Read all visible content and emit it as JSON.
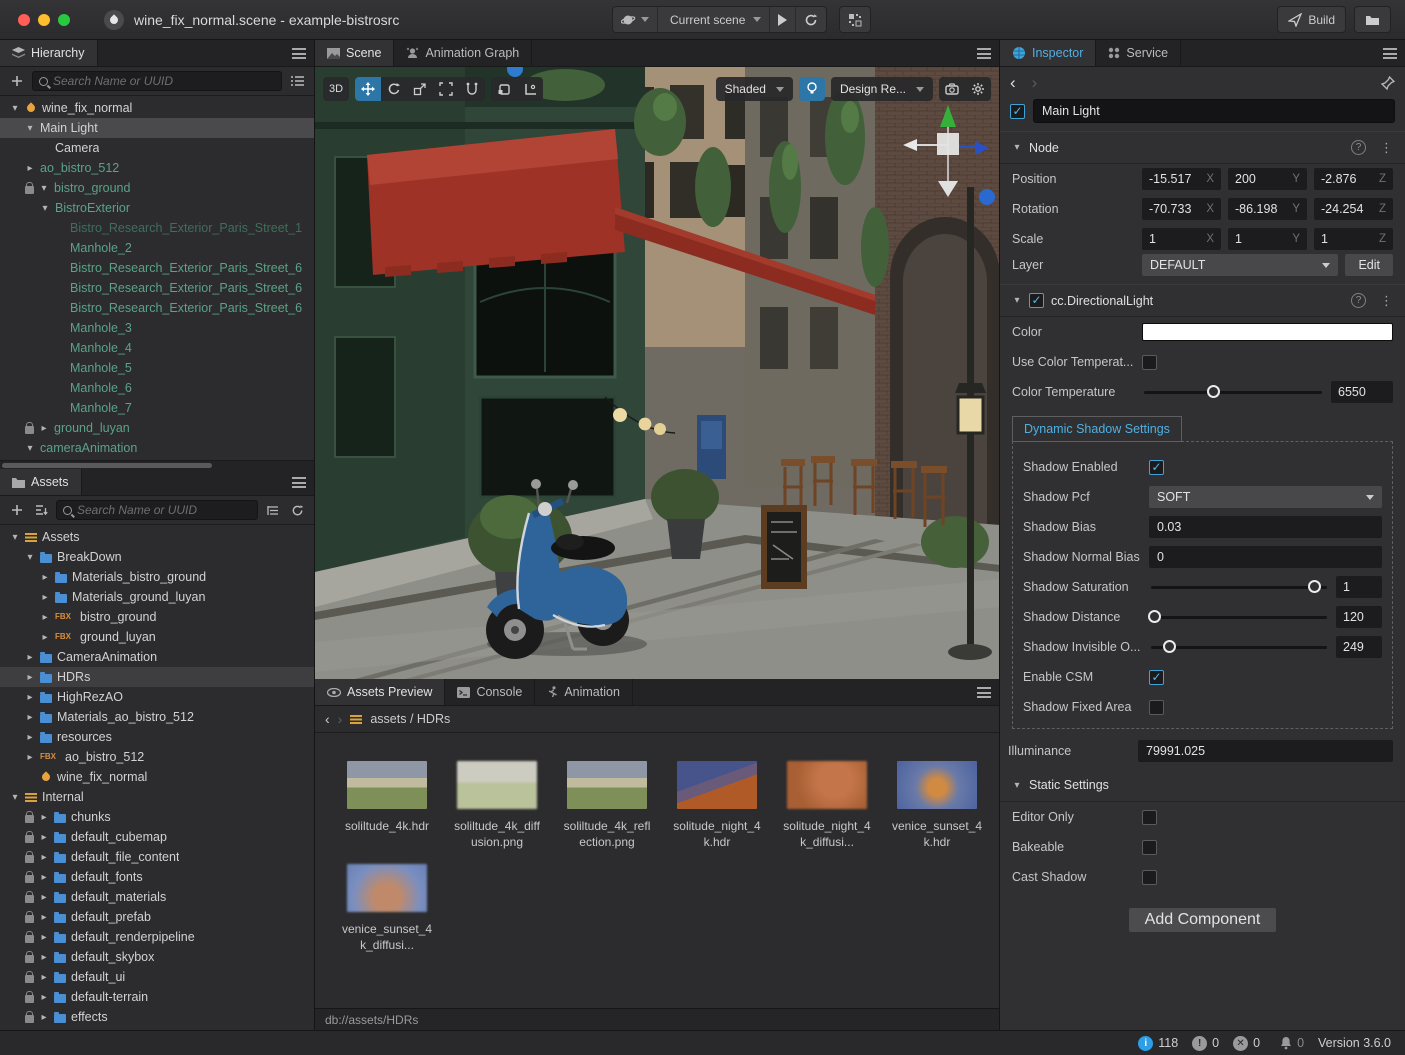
{
  "titlebar": {
    "title": "wine_fix_normal.scene - example-bistrosrc",
    "scene_select": "Current scene",
    "build_label": "Build"
  },
  "hierarchy": {
    "tab": "Hierarchy",
    "search_placeholder": "Search Name or UUID",
    "items": [
      {
        "arrow": "down",
        "icon": "droplet",
        "label": "wine_fix_normal",
        "indent": 0
      },
      {
        "arrow": "down",
        "label": "Main Light",
        "indent": 1,
        "cls": "selected"
      },
      {
        "label": "Camera",
        "indent": 2
      },
      {
        "arrow": "right",
        "label": "ao_bistro_512",
        "indent": 1,
        "cls": "green"
      },
      {
        "lock": true,
        "arrow": "down",
        "label": "bistro_ground",
        "indent": 1,
        "cls": "green"
      },
      {
        "arrow": "down",
        "label": "BistroExterior",
        "indent": 2,
        "cls": "green"
      },
      {
        "label": "Bistro_Research_Exterior_Paris_Street_1",
        "indent": 3,
        "cls": "green dim"
      },
      {
        "label": "Manhole_2",
        "indent": 3,
        "cls": "green"
      },
      {
        "label": "Bistro_Research_Exterior_Paris_Street_6",
        "indent": 3,
        "cls": "green"
      },
      {
        "label": "Bistro_Research_Exterior_Paris_Street_6",
        "indent": 3,
        "cls": "green"
      },
      {
        "label": "Bistro_Research_Exterior_Paris_Street_6",
        "indent": 3,
        "cls": "green"
      },
      {
        "label": "Manhole_3",
        "indent": 3,
        "cls": "green"
      },
      {
        "label": "Manhole_4",
        "indent": 3,
        "cls": "green"
      },
      {
        "label": "Manhole_5",
        "indent": 3,
        "cls": "green"
      },
      {
        "label": "Manhole_6",
        "indent": 3,
        "cls": "green"
      },
      {
        "label": "Manhole_7",
        "indent": 3,
        "cls": "green"
      },
      {
        "lock": true,
        "arrow": "right",
        "label": "ground_luyan",
        "indent": 1,
        "cls": "green"
      },
      {
        "arrow": "down",
        "label": "cameraAnimation",
        "indent": 1,
        "cls": "green"
      }
    ]
  },
  "assets": {
    "tab": "Assets",
    "search_placeholder": "Search Name or UUID",
    "items": [
      {
        "arrow": "down",
        "icon": "db",
        "label": "Assets",
        "indent": 0
      },
      {
        "arrow": "down",
        "icon": "folder",
        "label": "BreakDown",
        "indent": 1
      },
      {
        "arrow": "right",
        "icon": "folder",
        "label": "Materials_bistro_ground",
        "indent": 2
      },
      {
        "arrow": "right",
        "icon": "folder",
        "label": "Materials_ground_luyan",
        "indent": 2
      },
      {
        "arrow": "right",
        "icon": "fbx",
        "label": "bistro_ground",
        "indent": 2
      },
      {
        "arrow": "right",
        "icon": "fbx",
        "label": "ground_luyan",
        "indent": 2
      },
      {
        "arrow": "right",
        "icon": "folder",
        "label": "CameraAnimation",
        "indent": 1
      },
      {
        "arrow": "right",
        "icon": "folder",
        "label": "HDRs",
        "indent": 1,
        "cls": "hl"
      },
      {
        "arrow": "right",
        "icon": "folder",
        "label": "HighRezAO",
        "indent": 1
      },
      {
        "arrow": "right",
        "icon": "folder",
        "label": "Materials_ao_bistro_512",
        "indent": 1
      },
      {
        "arrow": "right",
        "icon": "folder",
        "label": "resources",
        "indent": 1
      },
      {
        "arrow": "right",
        "icon": "fbx",
        "label": "ao_bistro_512",
        "indent": 1
      },
      {
        "icon": "droplet",
        "label": "wine_fix_normal",
        "indent": 1
      },
      {
        "arrow": "down",
        "icon": "db",
        "label": "Internal",
        "indent": 0
      },
      {
        "lock": true,
        "arrow": "right",
        "icon": "folder",
        "label": "chunks",
        "indent": 1
      },
      {
        "lock": true,
        "arrow": "right",
        "icon": "folder",
        "label": "default_cubemap",
        "indent": 1
      },
      {
        "lock": true,
        "arrow": "right",
        "icon": "folder",
        "label": "default_file_content",
        "indent": 1
      },
      {
        "lock": true,
        "arrow": "right",
        "icon": "folder",
        "label": "default_fonts",
        "indent": 1
      },
      {
        "lock": true,
        "arrow": "right",
        "icon": "folder",
        "label": "default_materials",
        "indent": 1
      },
      {
        "lock": true,
        "arrow": "right",
        "icon": "folder",
        "label": "default_prefab",
        "indent": 1
      },
      {
        "lock": true,
        "arrow": "right",
        "icon": "folder",
        "label": "default_renderpipeline",
        "indent": 1
      },
      {
        "lock": true,
        "arrow": "right",
        "icon": "folder",
        "label": "default_skybox",
        "indent": 1
      },
      {
        "lock": true,
        "arrow": "right",
        "icon": "folder",
        "label": "default_ui",
        "indent": 1
      },
      {
        "lock": true,
        "arrow": "right",
        "icon": "folder",
        "label": "default-terrain",
        "indent": 1
      },
      {
        "lock": true,
        "arrow": "right",
        "icon": "folder",
        "label": "effects",
        "indent": 1
      }
    ]
  },
  "scene": {
    "tabs": [
      {
        "label": "Scene"
      },
      {
        "label": "Animation Graph"
      }
    ],
    "mode": "3D",
    "shading": "Shaded",
    "design": "Design Re..."
  },
  "preview": {
    "tabs": [
      {
        "label": "Assets Preview"
      },
      {
        "label": "Console"
      },
      {
        "label": "Animation"
      }
    ],
    "breadcrumb": "assets / HDRs",
    "path": "db://assets/HDRs",
    "files": [
      {
        "name": "soliltude_4k.hdr",
        "thumb": "field"
      },
      {
        "name": "soliltude_4k_diffusion.png",
        "thumb": "pale"
      },
      {
        "name": "soliltude_4k_reflection.png",
        "thumb": "field2"
      },
      {
        "name": "solitude_night_4k.hdr",
        "thumb": "night"
      },
      {
        "name": "solitude_night_4k_diffusi...",
        "thumb": "nightdiff"
      },
      {
        "name": "venice_sunset_4k.hdr",
        "thumb": "venice"
      },
      {
        "name": "venice_sunset_4k_diffusi...",
        "thumb": "venicediff"
      }
    ]
  },
  "inspector": {
    "tabs": [
      {
        "label": "Inspector"
      },
      {
        "label": "Service"
      }
    ],
    "node_name": "Main Light",
    "node_enabled": true,
    "axes": [
      "X",
      "Y",
      "Z"
    ],
    "node": {
      "title": "Node",
      "position": {
        "label": "Position",
        "x": "-15.517",
        "y": "200",
        "z": "-2.876"
      },
      "rotation": {
        "label": "Rotation",
        "x": "-70.733",
        "y": "-86.198",
        "z": "-24.254"
      },
      "scale": {
        "label": "Scale",
        "x": "1",
        "y": "1",
        "z": "1"
      },
      "layer": {
        "label": "Layer",
        "value": "DEFAULT",
        "edit": "Edit"
      }
    },
    "light": {
      "title": "cc.DirectionalLight",
      "enabled": true,
      "color_label": "Color",
      "color_value": "#ffffff",
      "use_color_temperature_label": "Use Color Temperat...",
      "use_color_temperature": false,
      "color_temperature": {
        "label": "Color Temperature",
        "value": "6550",
        "slider_pct": 40
      },
      "shadow_group_title": "Dynamic Shadow Settings",
      "shadow_enabled_label": "Shadow Enabled",
      "shadow_enabled": true,
      "shadow_pcf": {
        "label": "Shadow Pcf",
        "value": "SOFT"
      },
      "shadow_bias": {
        "label": "Shadow Bias",
        "value": "0.03"
      },
      "shadow_normal_bias": {
        "label": "Shadow Normal Bias",
        "value": "0"
      },
      "shadow_saturation": {
        "label": "Shadow Saturation",
        "value": "1",
        "slider_pct": 93
      },
      "shadow_distance": {
        "label": "Shadow Distance",
        "value": "120",
        "slider_pct": 4
      },
      "shadow_invisible": {
        "label": "Shadow Invisible O...",
        "value": "249",
        "slider_pct": 12
      },
      "enable_csm_label": "Enable CSM",
      "enable_csm": true,
      "shadow_fixed_area_label": "Shadow Fixed Area",
      "shadow_fixed_area": false,
      "illuminance": {
        "label": "Illuminance",
        "value": "79991.025"
      }
    },
    "static": {
      "title": "Static Settings",
      "editor_only_label": "Editor Only",
      "editor_only": false,
      "bakeable_label": "Bakeable",
      "bakeable": false,
      "cast_shadow_label": "Cast Shadow",
      "cast_shadow": false
    },
    "add_component_label": "Add Component"
  },
  "statusbar": {
    "info": "118",
    "warnings": "0",
    "errors": "0",
    "notifications": "0",
    "version": "Version 3.6.0"
  }
}
